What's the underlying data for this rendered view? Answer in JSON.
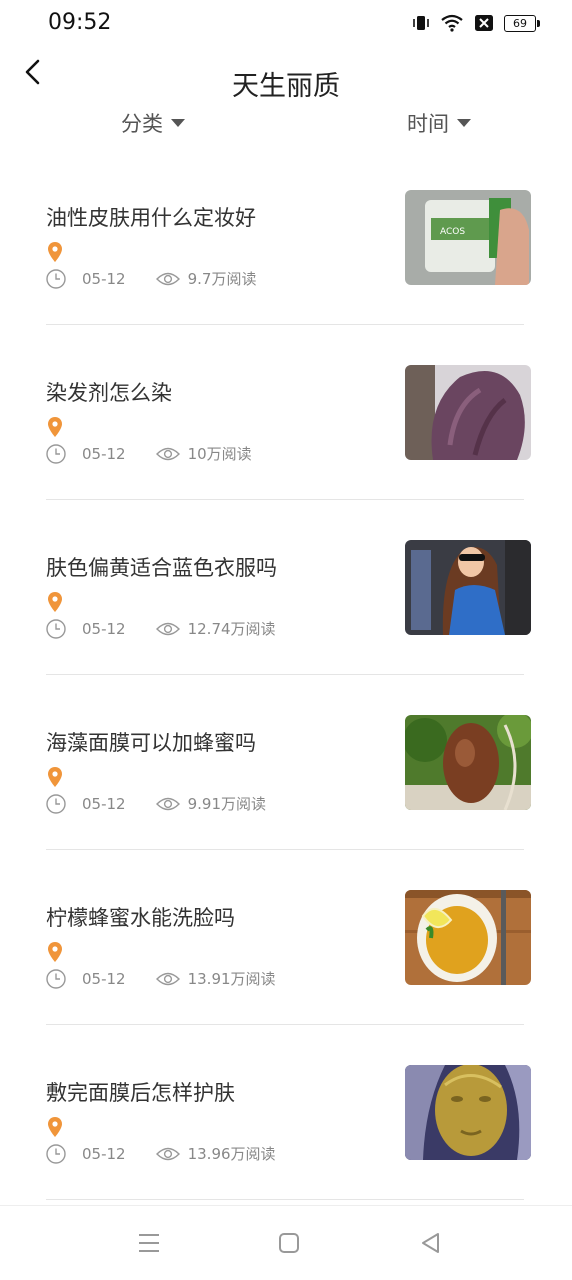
{
  "status": {
    "time": "09:52",
    "battery": "69"
  },
  "header": {
    "title": "天生丽质"
  },
  "filters": {
    "category": "分类",
    "time": "时间"
  },
  "articles": [
    {
      "title": "油性皮肤用什么定妆好",
      "date": "05-12",
      "reads": "9.7万阅读"
    },
    {
      "title": "染发剂怎么染",
      "date": "05-12",
      "reads": "10万阅读"
    },
    {
      "title": "肤色偏黄适合蓝色衣服吗",
      "date": "05-12",
      "reads": "12.74万阅读"
    },
    {
      "title": "海藻面膜可以加蜂蜜吗",
      "date": "05-12",
      "reads": "9.91万阅读"
    },
    {
      "title": "柠檬蜂蜜水能洗脸吗",
      "date": "05-12",
      "reads": "13.91万阅读"
    },
    {
      "title": "敷完面膜后怎样护肤",
      "date": "05-12",
      "reads": "13.96万阅读"
    }
  ],
  "colors": {
    "accent": "#f0953a",
    "meta": "#888888",
    "divider": "#e5e5e5"
  }
}
